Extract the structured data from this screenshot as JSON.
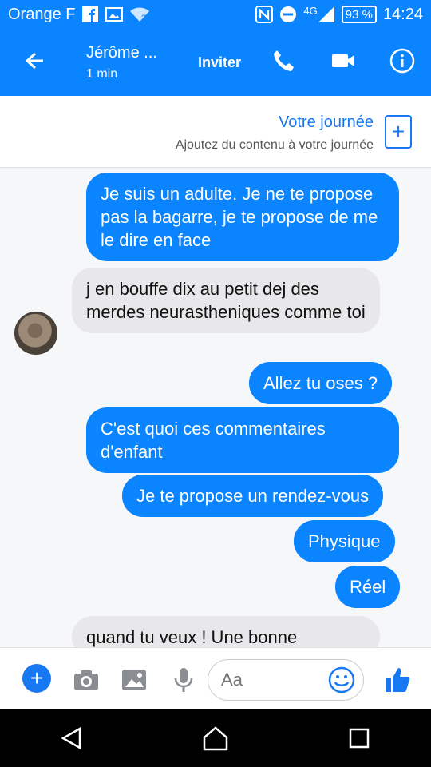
{
  "status": {
    "carrier": "Orange F",
    "network": "4G",
    "battery": "93 %",
    "time": "14:24",
    "icons": [
      "facebook-icon",
      "gallery-icon",
      "wifi-icon",
      "nfc-icon",
      "do-not-disturb-icon",
      "signal-icon",
      "battery-icon"
    ]
  },
  "header": {
    "contact_name": "Jérôme ...",
    "last_active": "1 min",
    "invite": "Inviter",
    "icons": [
      "back-arrow-icon",
      "phone-icon",
      "video-camera-icon",
      "info-icon"
    ]
  },
  "journey": {
    "title": "Votre journée",
    "subtitle": "Ajoutez du contenu à votre journée",
    "add_symbol": "+"
  },
  "messages": [
    {
      "side": "out",
      "text": "Je suis un adulte. Je ne te propose pas la bagarre, je te propose de me le dire en face"
    },
    {
      "side": "in",
      "text": "j en bouffe dix au petit dej des merdes neurastheniques comme toi"
    },
    {
      "side": "out",
      "text": "Allez tu oses ?"
    },
    {
      "side": "out",
      "text": "C'est quoi ces commentaires d'enfant"
    },
    {
      "side": "out",
      "text": "Je te propose un rendez-vous"
    },
    {
      "side": "out",
      "text": "Physique"
    },
    {
      "side": "out",
      "text": "Réel"
    },
    {
      "side": "in",
      "text": "quand tu veux ! Une bonne"
    }
  ],
  "composer": {
    "placeholder": "Aa",
    "plus_symbol": "+",
    "icons": [
      "plus-icon",
      "camera-icon",
      "image-icon",
      "microphone-icon",
      "emoji-icon",
      "like-icon"
    ]
  },
  "navbar": {
    "icons": [
      "back-nav-icon",
      "home-nav-icon",
      "recents-nav-icon"
    ]
  },
  "colors": {
    "brand_blue": "#0a84ff",
    "incoming_bubble": "#e8e8eb",
    "background": "#f6f7f9"
  }
}
